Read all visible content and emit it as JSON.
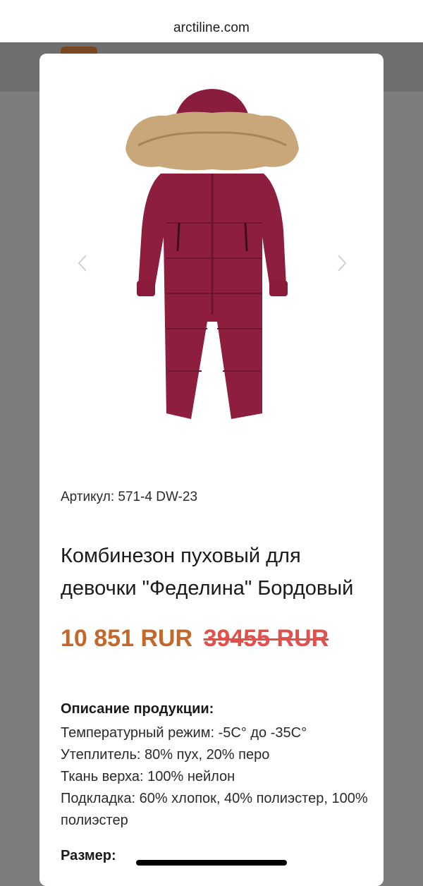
{
  "browser": {
    "url": "arctiline.com"
  },
  "product": {
    "sku_label": "Артикул:",
    "sku_value": "571-4 DW-23",
    "title": "Комбинезон пуховый для девочки \"Феделина\" Бордовый",
    "price_current": "10 851 RUR",
    "price_old": "39455 RUR",
    "description_heading": "Описание продукции:",
    "description_lines": [
      "Температурный режим: -5С° до -35С°",
      "Утеплитель: 80% пух, 20% перо",
      "Ткань верха: 100% нейлон",
      "Подкладка: 60% хлопок, 40% полиэстер, 100% полиэстер"
    ],
    "size_label": "Размер:"
  },
  "colors": {
    "price_current": "#c3682a",
    "price_old": "#e2504c",
    "garment": "#8e1e3e",
    "fur": "#c9a77a"
  },
  "icons": {
    "prev": "chevron-left-icon",
    "next": "chevron-right-icon"
  }
}
